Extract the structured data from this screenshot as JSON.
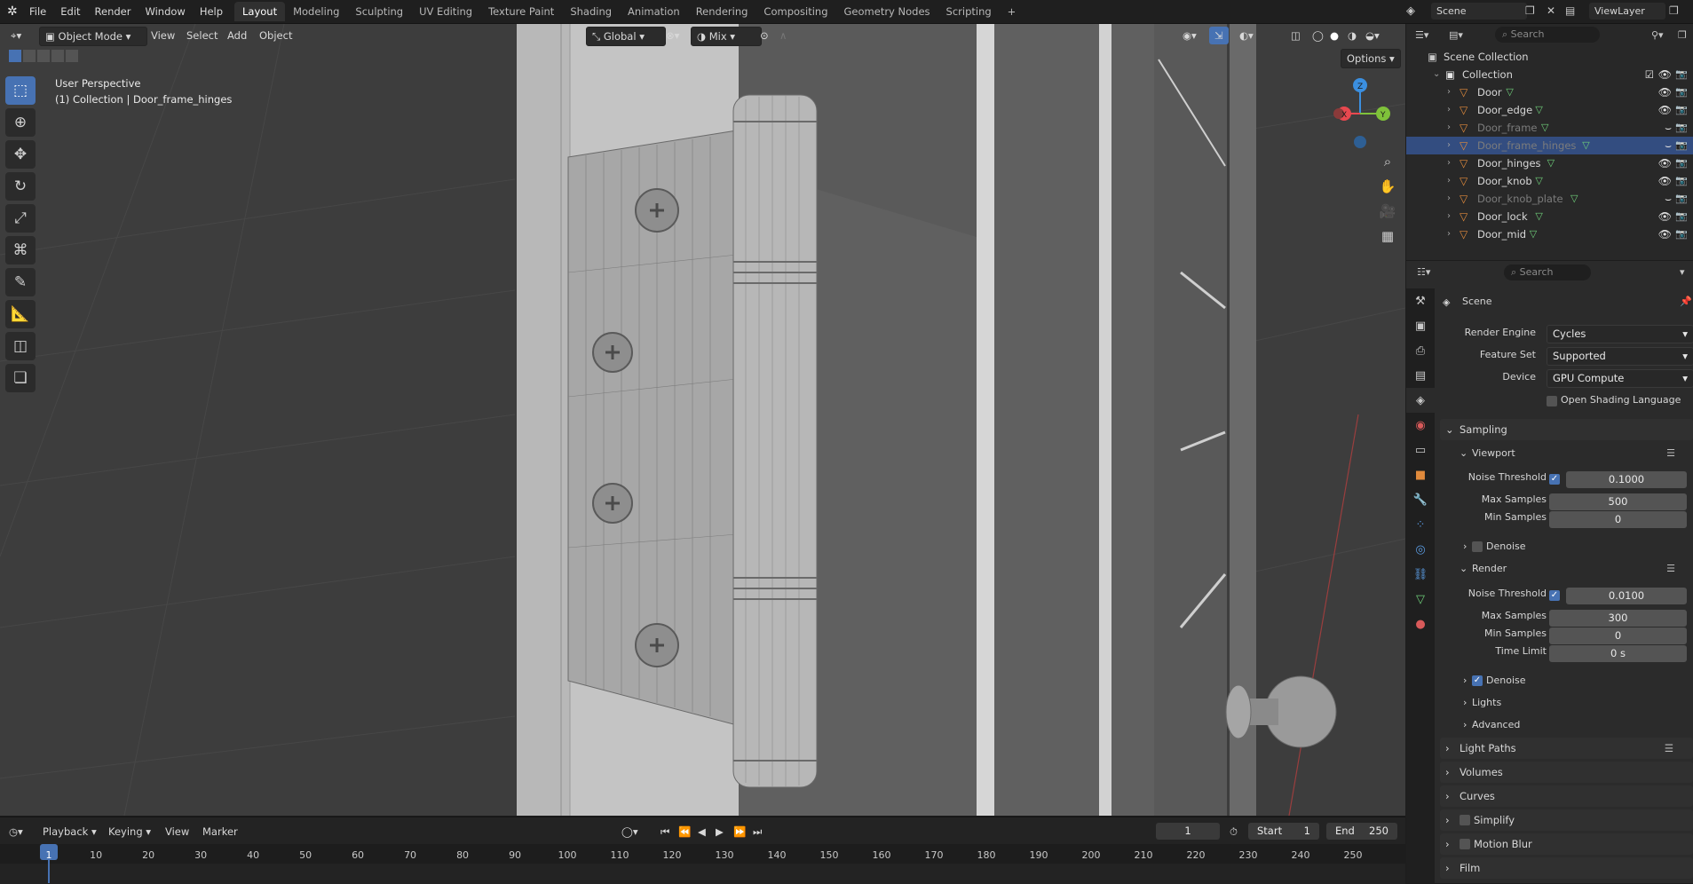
{
  "app": {
    "menu": [
      "File",
      "Edit",
      "Render",
      "Window",
      "Help"
    ],
    "workspaces": [
      "Layout",
      "Modeling",
      "Sculpting",
      "UV Editing",
      "Texture Paint",
      "Shading",
      "Animation",
      "Rendering",
      "Compositing",
      "Geometry Nodes",
      "Scripting"
    ],
    "active_workspace": "Layout",
    "add_tab": "+",
    "scene_name": "Scene",
    "view_layer": "ViewLayer"
  },
  "viewport": {
    "mode": "Object Mode",
    "menus": [
      "View",
      "Select",
      "Add",
      "Object"
    ],
    "transform_orientation": "Global",
    "snap_mode": "Mix",
    "options_label": "Options",
    "perspective_label": "User Perspective",
    "collection_label": "(1) Collection | Door_frame_hinges",
    "gizmo_axes": [
      "X",
      "Y",
      "Z"
    ]
  },
  "outliner": {
    "search_placeholder": "Search",
    "scene_collection": "Scene Collection",
    "collection": "Collection",
    "objects": [
      {
        "name": "Door",
        "visible": true,
        "selected": false
      },
      {
        "name": "Door_edge",
        "visible": true,
        "selected": false
      },
      {
        "name": "Door_frame",
        "visible": false,
        "selected": false
      },
      {
        "name": "Door_frame_hinges",
        "visible": false,
        "selected": true
      },
      {
        "name": "Door_hinges",
        "visible": true,
        "selected": false
      },
      {
        "name": "Door_knob",
        "visible": true,
        "selected": false
      },
      {
        "name": "Door_knob_plate",
        "visible": false,
        "selected": false
      },
      {
        "name": "Door_lock",
        "visible": true,
        "selected": false
      },
      {
        "name": "Door_mid",
        "visible": true,
        "selected": false
      }
    ]
  },
  "properties": {
    "search_placeholder": "Search",
    "context_title": "Scene",
    "render_engine_label": "Render Engine",
    "render_engine": "Cycles",
    "feature_set_label": "Feature Set",
    "feature_set": "Supported",
    "device_label": "Device",
    "device": "GPU Compute",
    "osl_label": "Open Shading Language",
    "sampling": {
      "title": "Sampling",
      "viewport_title": "Viewport",
      "viewport": {
        "noise_threshold_label": "Noise Threshold",
        "noise_threshold": "0.1000",
        "max_samples_label": "Max Samples",
        "max_samples": "500",
        "min_samples_label": "Min Samples",
        "min_samples": "0"
      },
      "viewport_denoise": "Denoise",
      "render_title": "Render",
      "render": {
        "noise_threshold_label": "Noise Threshold",
        "noise_threshold": "0.0100",
        "max_samples_label": "Max Samples",
        "max_samples": "300",
        "min_samples_label": "Min Samples",
        "min_samples": "0",
        "time_limit_label": "Time Limit",
        "time_limit": "0 s"
      },
      "render_denoise": "Denoise",
      "lights": "Lights",
      "advanced": "Advanced"
    },
    "panels": [
      "Light Paths",
      "Volumes",
      "Curves",
      "Simplify",
      "Motion Blur",
      "Film"
    ]
  },
  "timeline": {
    "menus": [
      "Playback",
      "Keying",
      "View",
      "Marker"
    ],
    "current_frame": "1",
    "start_label": "Start",
    "start": "1",
    "end_label": "End",
    "end": "250",
    "ticks": [
      "1",
      "10",
      "20",
      "30",
      "40",
      "50",
      "60",
      "70",
      "80",
      "90",
      "100",
      "110",
      "120",
      "130",
      "140",
      "150",
      "160",
      "170",
      "180",
      "190",
      "200",
      "210",
      "220",
      "230",
      "240",
      "250"
    ]
  },
  "colors": {
    "accent": "#4772b3",
    "selection": "#334d80",
    "object_icon": "#e08a3c",
    "mesh_icon": "#6fcf7a",
    "axis_x": "#e8484f",
    "axis_y": "#7fc23a",
    "axis_z": "#3b8fe0"
  }
}
